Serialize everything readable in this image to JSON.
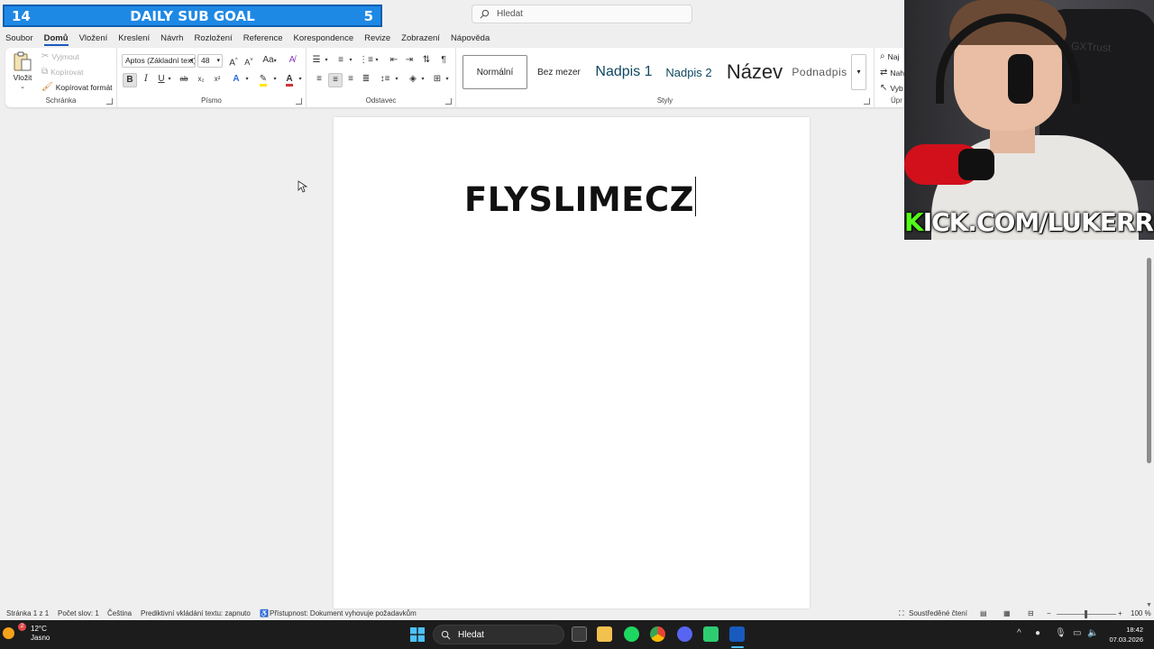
{
  "overlay": {
    "sub_goal": {
      "current": "14",
      "title": "DAILY SUB GOAL",
      "target": "5"
    }
  },
  "titlebar": {
    "search_placeholder": "Hledat"
  },
  "menu": {
    "tabs": [
      "Soubor",
      "Domů",
      "Vložení",
      "Kreslení",
      "Návrh",
      "Rozložení",
      "Reference",
      "Korespondence",
      "Revize",
      "Zobrazení",
      "Nápověda"
    ],
    "active_tab": "Domů"
  },
  "ribbon": {
    "clipboard": {
      "paste": "Vložit",
      "cut": "Vyjmout",
      "copy": "Kopírovat",
      "format_painter": "Kopírovat formát",
      "label": "Schránka"
    },
    "font": {
      "family": "Aptos (Základní text)",
      "size": "48",
      "case": "Aa",
      "label": "Písmo",
      "bold": "B",
      "italic": "I",
      "underline": "U",
      "strike": "ab",
      "sub": "x₂",
      "sup": "x²"
    },
    "paragraph": {
      "label": "Odstavec",
      "pilcrow": "¶"
    },
    "styles": {
      "items": [
        "Normální",
        "Bez mezer",
        "Nadpis 1",
        "Nadpis 2",
        "Název",
        "Podnadpis"
      ],
      "selected": "Normální",
      "label": "Styly"
    },
    "editing": {
      "find": "Naj",
      "replace": "Nah",
      "select": "Vyb",
      "label": "Úpr"
    }
  },
  "document": {
    "text": "FLYSLIMECZ"
  },
  "statusbar": {
    "page": "Stránka 1 z 1",
    "words": "Počet slov: 1",
    "language": "Čeština",
    "predictive": "Prediktivní vkládání textu: zapnuto",
    "accessibility": "Přístupnost: Dokument vyhovuje požadavkům",
    "focus": "Soustředěné čtení",
    "zoom": "100 %"
  },
  "taskbar": {
    "weather_temp": "12°C",
    "weather_desc": "Jasno",
    "weather_badge": "2",
    "search_placeholder": "Hledat",
    "time": "18:42",
    "date": "07.03.2026"
  },
  "webcam": {
    "banner_first": "K",
    "banner_rest": "ICK.COM/LUKERRIS",
    "chair_brand": "GXTrust"
  },
  "colors": {
    "sub_goal_bg": "#1e88e5",
    "kick_green": "#53fc18",
    "word_blue": "#185abd",
    "heading_blue": "#0f4761"
  }
}
